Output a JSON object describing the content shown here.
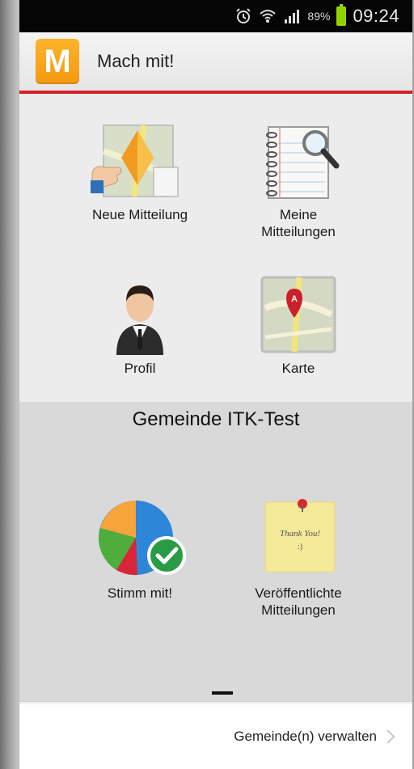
{
  "status_bar": {
    "icons": [
      "alarm-icon",
      "wifi-icon",
      "signal-icon",
      "battery-icon"
    ],
    "battery_percent": "89%",
    "time": "09:24"
  },
  "app_bar": {
    "logo_letter": "M",
    "title": "Mach mit!",
    "accent_color": "#d32026",
    "logo_color": "#f7a41d"
  },
  "menu": {
    "items": [
      {
        "label": "Neue Mitteilung",
        "icon": "new-report-map-icon"
      },
      {
        "label": "Meine\nMitteilungen",
        "icon": "notebook-search-icon"
      },
      {
        "label": "Profil",
        "icon": "person-icon"
      },
      {
        "label": "Karte",
        "icon": "map-pin-icon"
      }
    ]
  },
  "community": {
    "title": "Gemeinde ITK-Test",
    "items": [
      {
        "label": "Stimm mit!",
        "icon": "pie-chart-check-icon"
      },
      {
        "label": "Veröffentlichte\nMitteilungen",
        "icon": "sticky-note-icon",
        "note_text": "Thank You!",
        "note_subtext": ":)"
      }
    ]
  },
  "footer": {
    "manage_label": "Gemeinde(n) verwalten"
  }
}
